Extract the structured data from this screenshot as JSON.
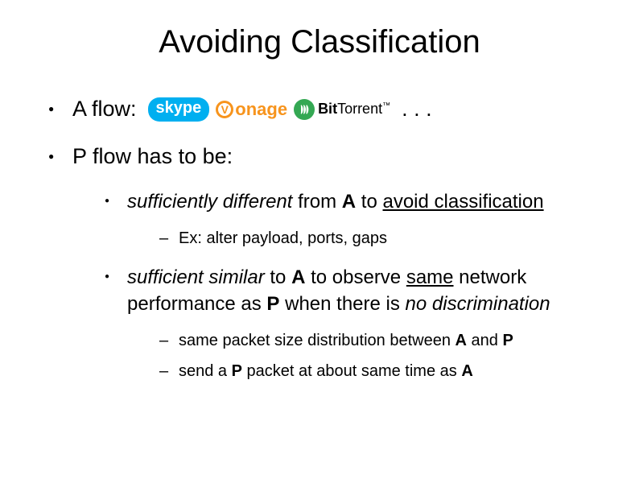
{
  "title": "Avoiding Classification",
  "bullets": {
    "a_flow_label": "A flow:",
    "dots": ". . .",
    "p_flow": "P flow has to be:",
    "sub1_pre": "sufficiently different",
    "sub1_mid": " from ",
    "sub1_a": "A",
    "sub1_mid2": " to ",
    "sub1_avoid": "avoid classification",
    "sub1_ex": "Ex: alter payload, ports, gaps",
    "sub2_pre": "sufficient similar",
    "sub2_mid": " to ",
    "sub2_a": "A",
    "sub2_mid2": " to observe ",
    "sub2_same": "same",
    "sub2_mid3": " network performance as ",
    "sub2_p": "P",
    "sub2_mid4": " when there is ",
    "sub2_nodisc": "no discrimination",
    "sub2_ex1_a": "same packet size distribution between ",
    "sub2_ex1_b": "A",
    "sub2_ex1_c": " and ",
    "sub2_ex1_d": "P",
    "sub2_ex2_a": "send a ",
    "sub2_ex2_b": "P",
    "sub2_ex2_c": " packet at about same time as ",
    "sub2_ex2_d": "A"
  },
  "logos": {
    "skype": "skype",
    "vonage_v": "V",
    "vonage_rest": "onage",
    "bt_bit": "Bit",
    "bt_torrent": "Torrent",
    "bt_tm": "™"
  }
}
